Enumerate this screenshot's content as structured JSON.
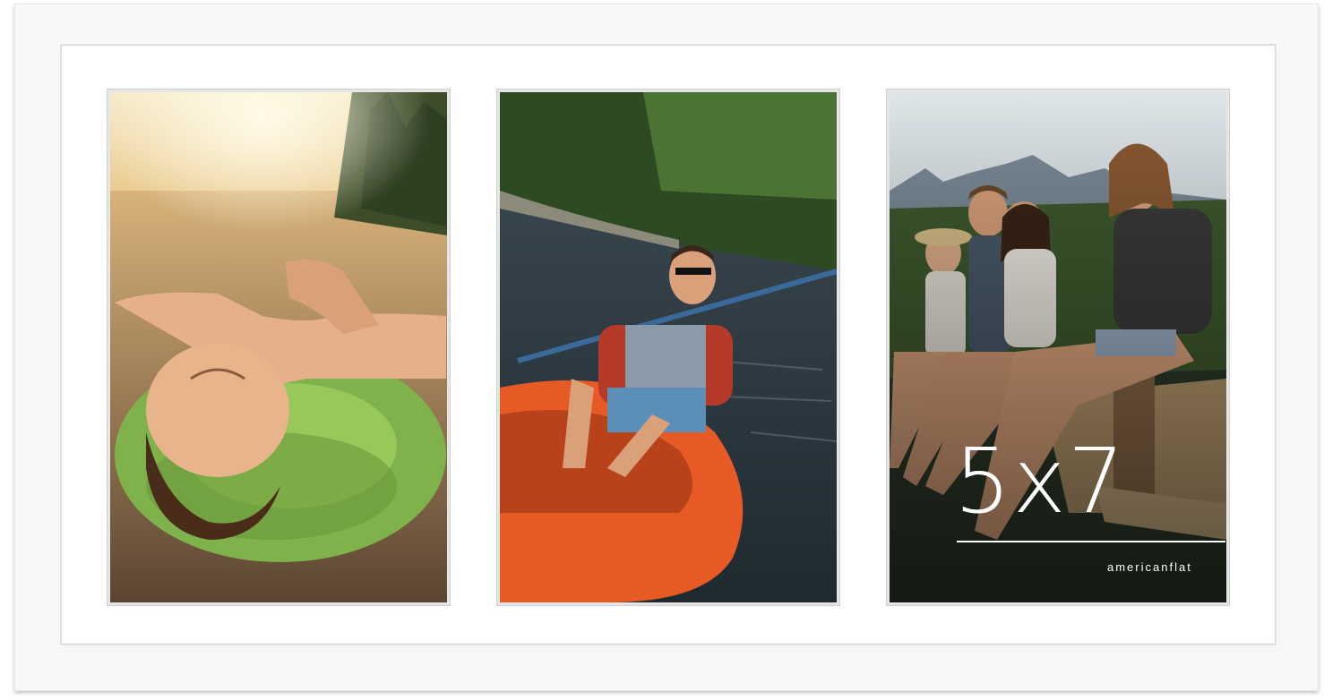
{
  "frame": {
    "color": "#f7f7f7",
    "mat_color": "#ffffff",
    "openings": [
      {
        "subject": "woman relaxing on green inflatable ring in lake at sunset"
      },
      {
        "subject": "smiling man paddling orange kayak on river"
      },
      {
        "subject": "group of friends sitting on wooden dock"
      }
    ]
  },
  "overlay": {
    "size_label": "5x7",
    "brand": "americanflat"
  }
}
